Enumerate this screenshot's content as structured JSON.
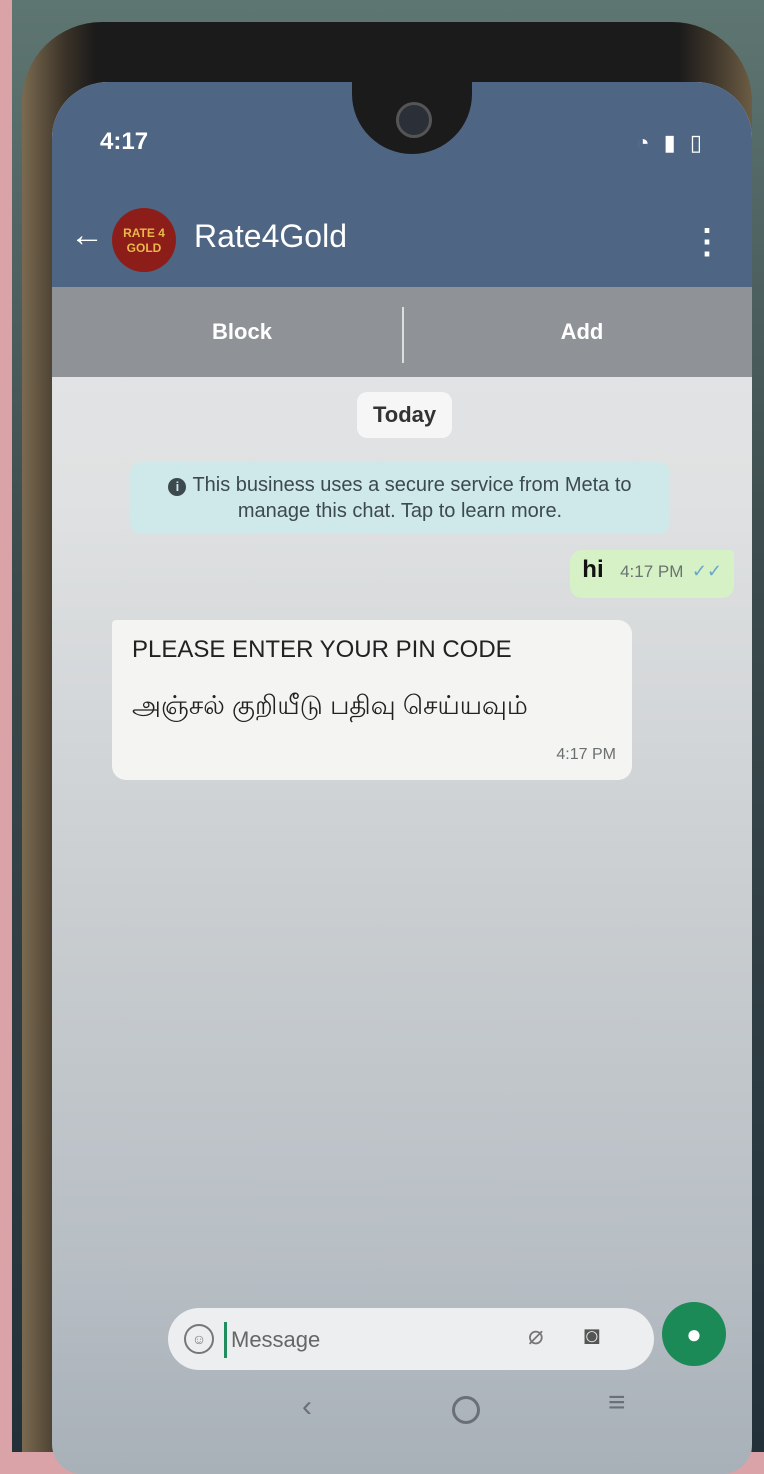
{
  "status": {
    "time": "4:17",
    "icons": "wifi signal battery"
  },
  "header": {
    "back_icon": "←",
    "avatar_text_top": "RATE 4",
    "avatar_text_bottom": "GOLD",
    "contact_name": "Rate4Gold",
    "menu_icon": "⋮"
  },
  "actions": {
    "block_label": "Block",
    "add_label": "Add"
  },
  "chat": {
    "date_label": "Today",
    "system_notice": "This business uses a secure service from Meta to manage this chat. Tap to learn more.",
    "outgoing": {
      "text": "hi",
      "time": "4:17 PM",
      "ticks": "✓✓"
    },
    "incoming": {
      "line1": "PLEASE ENTER YOUR PIN CODE",
      "line2": "அஞ்சல் குறியீடு பதிவு செய்யவும்",
      "time": "4:17 PM"
    }
  },
  "composer": {
    "placeholder": "Message"
  },
  "colors": {
    "header": "#4e6683",
    "outgoing_bubble": "#d6f1c6",
    "mic": "#1c8a56"
  }
}
